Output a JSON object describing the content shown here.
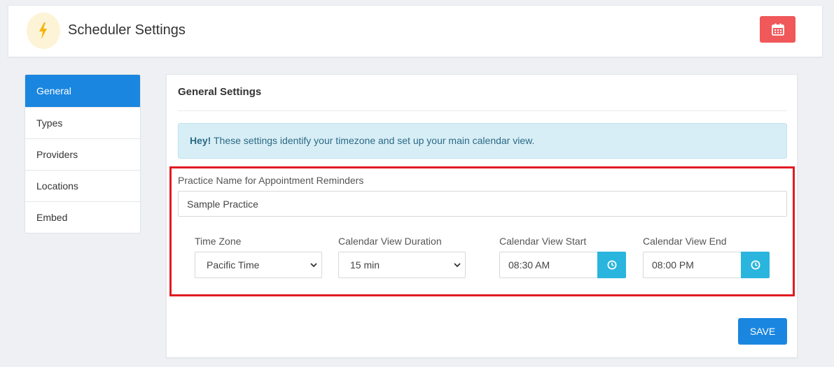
{
  "header": {
    "title": "Scheduler Settings",
    "logo_icon": "lightning-bolt-icon",
    "calendar_button_icon": "calendar-icon",
    "calendar_button_color": "#f0585a"
  },
  "sidebar": {
    "items": [
      {
        "label": "General",
        "active": true
      },
      {
        "label": "Types",
        "active": false
      },
      {
        "label": "Providers",
        "active": false
      },
      {
        "label": "Locations",
        "active": false
      },
      {
        "label": "Embed",
        "active": false
      }
    ],
    "active_color": "#1a86df"
  },
  "main": {
    "title": "General Settings",
    "alert": {
      "strong": "Hey!",
      "text": " These settings identify your timezone and set up your main calendar view."
    },
    "practice_name": {
      "label": "Practice Name for Appointment Reminders",
      "value": "Sample Practice"
    },
    "time_zone": {
      "label": "Time Zone",
      "value": "Pacific Time"
    },
    "calendar_duration": {
      "label": "Calendar View Duration",
      "value": "15 min"
    },
    "calendar_start": {
      "label": "Calendar View Start",
      "value": "08:30 AM"
    },
    "calendar_end": {
      "label": "Calendar View End",
      "value": "08:00 PM"
    },
    "save_label": "SAVE"
  }
}
